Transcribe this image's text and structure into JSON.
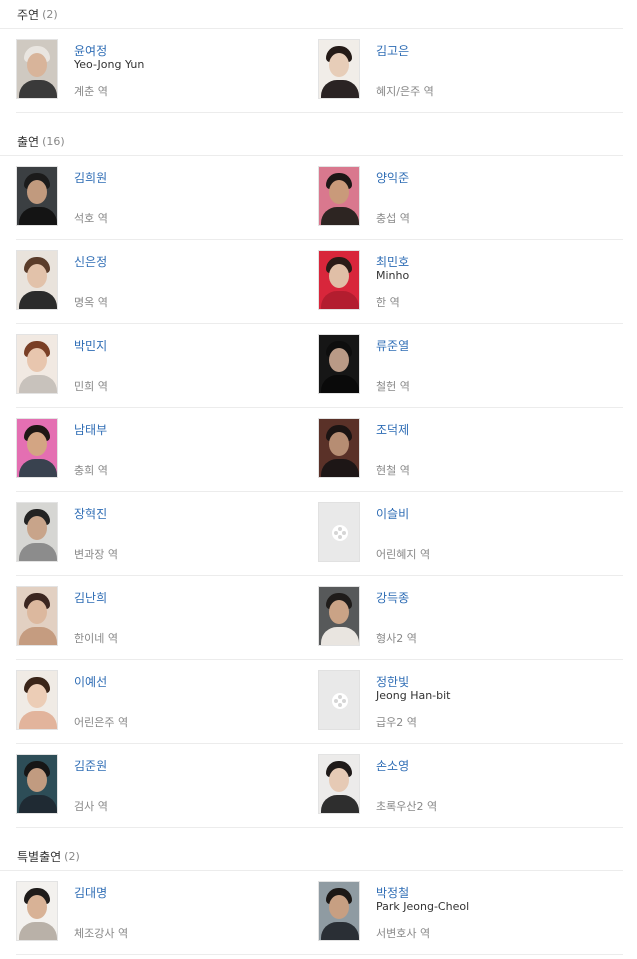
{
  "sections": [
    {
      "title": "주연",
      "count": "(2)",
      "rows": [
        [
          {
            "name": "윤여정",
            "eng": "Yeo-Jong Yun",
            "role": "계춘 역",
            "photo": true,
            "bg": "#cfc9c1",
            "skin": "#d8b49a",
            "hair": "#e9e5e0",
            "cloth": "#3a3a3a"
          },
          {
            "name": "김고은",
            "eng": "",
            "role": "혜지/은주 역",
            "photo": true,
            "bg": "#f1ede8",
            "skin": "#e7cdb8",
            "hair": "#241a16",
            "cloth": "#2a2323"
          }
        ]
      ]
    },
    {
      "title": "출연",
      "count": "(16)",
      "rows": [
        [
          {
            "name": "김희원",
            "eng": "",
            "role": "석호 역",
            "photo": true,
            "bg": "#3b3f42",
            "skin": "#c19a7e",
            "hair": "#1b1b1b",
            "cloth": "#141414"
          },
          {
            "name": "양익준",
            "eng": "",
            "role": "충섭 역",
            "photo": true,
            "bg": "#d9788e",
            "skin": "#c99a7a",
            "hair": "#1d1716",
            "cloth": "#2d2522"
          }
        ],
        [
          {
            "name": "신은정",
            "eng": "",
            "role": "명옥 역",
            "photo": true,
            "bg": "#e9e3dc",
            "skin": "#e2c2aa",
            "hair": "#5a3c2a",
            "cloth": "#2b2b2b"
          },
          {
            "name": "최민호",
            "eng": "Minho",
            "role": "한 역",
            "photo": true,
            "bg": "#d8263b",
            "skin": "#e0bfa7",
            "hair": "#2a1b17",
            "cloth": "#b31d2f"
          }
        ],
        [
          {
            "name": "박민지",
            "eng": "",
            "role": "민희 역",
            "photo": true,
            "bg": "#f1e9e2",
            "skin": "#e8c6ae",
            "hair": "#7a3f26",
            "cloth": "#c8c2bc"
          },
          {
            "name": "류준열",
            "eng": "",
            "role": "철헌 역",
            "photo": true,
            "bg": "#161616",
            "skin": "#b99a86",
            "hair": "#0e0e0e",
            "cloth": "#0a0a0a"
          }
        ],
        [
          {
            "name": "남태부",
            "eng": "",
            "role": "충희 역",
            "photo": true,
            "bg": "#e46fb2",
            "skin": "#d3a583",
            "hair": "#1e1714",
            "cloth": "#39424f"
          },
          {
            "name": "조덕제",
            "eng": "",
            "role": "현철 역",
            "photo": true,
            "bg": "#5a3128",
            "skin": "#b68d73",
            "hair": "#1b1413",
            "cloth": "#1d1616"
          }
        ],
        [
          {
            "name": "장혁진",
            "eng": "",
            "role": "변과장 역",
            "photo": true,
            "bg": "#d6d6d3",
            "skin": "#c8a48a",
            "hair": "#232323",
            "cloth": "#8c8c8c"
          },
          {
            "name": "이슬비",
            "eng": "",
            "role": "어린혜지 역",
            "photo": false
          }
        ],
        [
          {
            "name": "김난희",
            "eng": "",
            "role": "한이네 역",
            "photo": true,
            "bg": "#e2d0c2",
            "skin": "#dcb89e",
            "hair": "#3b2620",
            "cloth": "#c59c80"
          },
          {
            "name": "강득종",
            "eng": "",
            "role": "형사2 역",
            "photo": true,
            "bg": "#57595a",
            "skin": "#caa386",
            "hair": "#1f1c1a",
            "cloth": "#e9e5e0"
          }
        ],
        [
          {
            "name": "이예선",
            "eng": "",
            "role": "어린은주 역",
            "photo": true,
            "bg": "#f0ebe5",
            "skin": "#eccdb6",
            "hair": "#3a2519",
            "cloth": "#e2b49c"
          },
          {
            "name": "정한빛",
            "eng": "Jeong Han-bit",
            "role": "급우2 역",
            "photo": false
          }
        ],
        [
          {
            "name": "김준원",
            "eng": "",
            "role": "검사 역",
            "photo": true,
            "bg": "#2d4d57",
            "skin": "#c19b80",
            "hair": "#161616",
            "cloth": "#1f2a33"
          },
          {
            "name": "손소영",
            "eng": "",
            "role": "초록우산2 역",
            "photo": true,
            "bg": "#ecebea",
            "skin": "#e6cab5",
            "hair": "#1f1a19",
            "cloth": "#2e2e2e"
          }
        ]
      ]
    },
    {
      "title": "특별출연",
      "count": "(2)",
      "rows": [
        [
          {
            "name": "김대명",
            "eng": "",
            "role": "체조강사 역",
            "photo": true,
            "bg": "#f3f1ee",
            "skin": "#d8b296",
            "hair": "#1f1c1b",
            "cloth": "#b9b1a8"
          },
          {
            "name": "박정철",
            "eng": "Park Jeong-Cheol",
            "role": "서변호사 역",
            "photo": true,
            "bg": "#8f9ba2",
            "skin": "#c79f82",
            "hair": "#1c1816",
            "cloth": "#2a2f35"
          }
        ]
      ]
    }
  ]
}
